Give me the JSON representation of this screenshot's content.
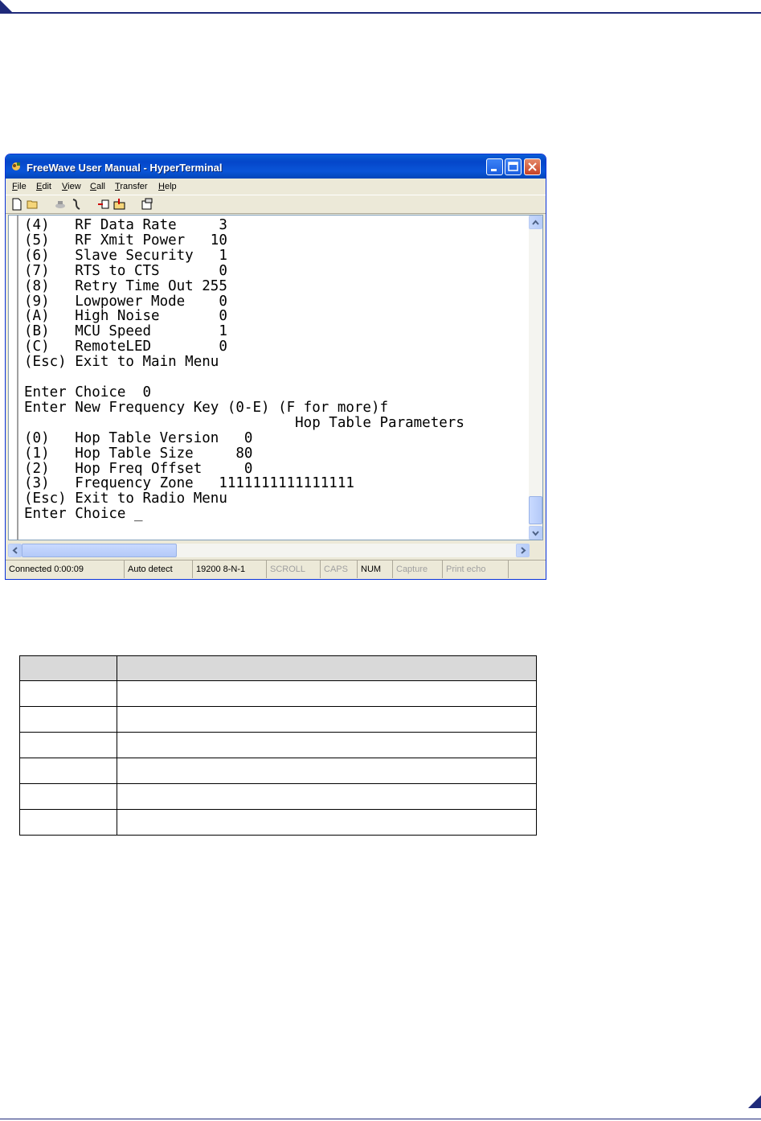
{
  "window": {
    "title": "FreeWave User Manual - HyperTerminal"
  },
  "menu": [
    "File",
    "Edit",
    "View",
    "Call",
    "Transfer",
    "Help"
  ],
  "toolbar_icons": [
    "new-file-icon",
    "open-folder-icon",
    "connect-icon",
    "disconnect-icon",
    "send-icon",
    "receive-icon",
    "properties-icon"
  ],
  "terminal": {
    "lines": [
      "(4)   RF Data Rate     3",
      "(5)   RF Xmit Power   10",
      "(6)   Slave Security   1",
      "(7)   RTS to CTS       0",
      "(8)   Retry Time Out 255",
      "(9)   Lowpower Mode    0",
      "(A)   High Noise       0",
      "(B)   MCU Speed        1",
      "(C)   RemoteLED        0",
      "(Esc) Exit to Main Menu",
      "",
      "Enter Choice  0",
      "Enter New Frequency Key (0-E) (F for more)f",
      "                                Hop Table Parameters",
      "(0)   Hop Table Version   0",
      "(1)   Hop Table Size     80",
      "(2)   Hop Freq Offset     0",
      "(3)   Frequency Zone   1111111111111111",
      "(Esc) Exit to Radio Menu",
      "Enter Choice _"
    ]
  },
  "status": {
    "connected": "Connected 0:00:09",
    "detect": "Auto detect",
    "settings": "19200 8-N-1",
    "scroll": "SCROLL",
    "caps": "CAPS",
    "num": "NUM",
    "capture": "Capture",
    "print_echo": "Print echo"
  },
  "table": {
    "header": [
      "",
      ""
    ],
    "rows": [
      [
        "",
        ""
      ],
      [
        "",
        ""
      ],
      [
        "",
        ""
      ],
      [
        "",
        ""
      ],
      [
        "",
        ""
      ],
      [
        "",
        ""
      ]
    ]
  }
}
